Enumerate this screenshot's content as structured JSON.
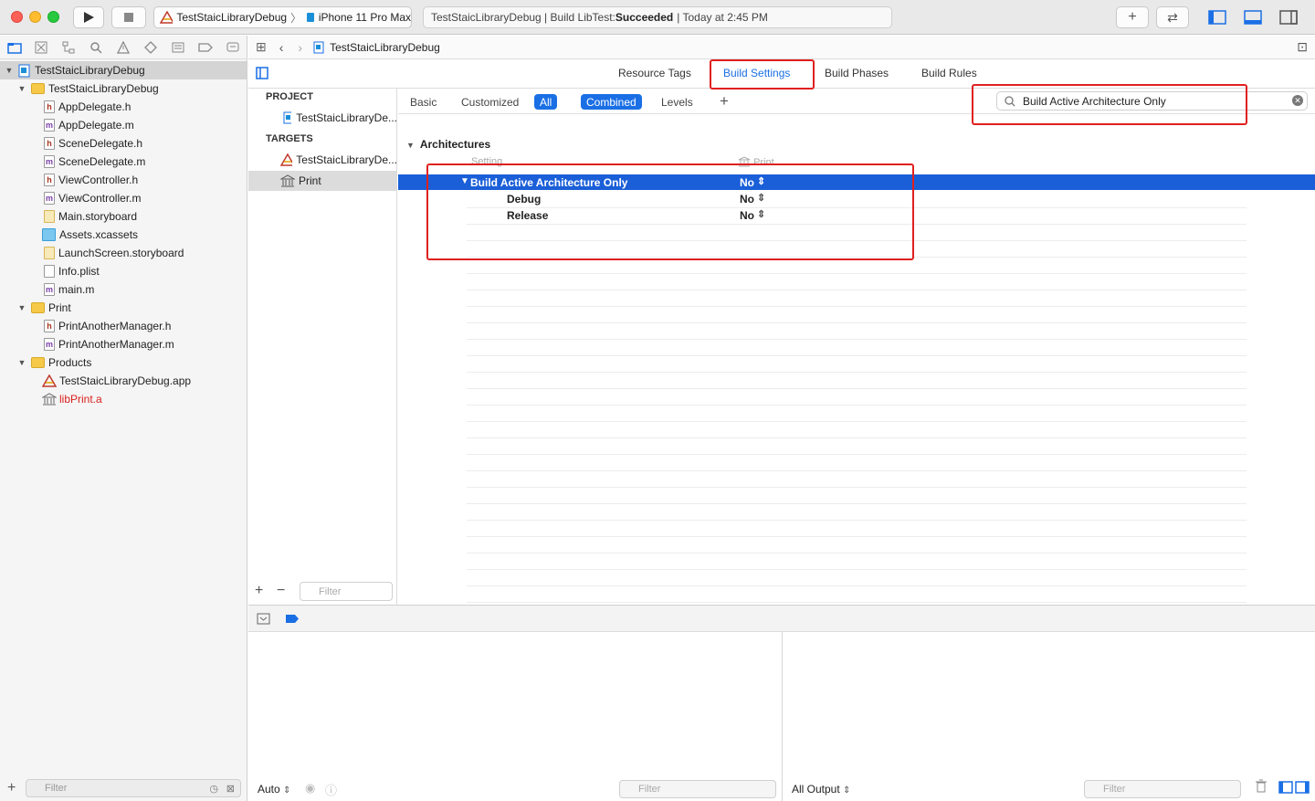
{
  "toolbar": {
    "scheme_name": "TestStaicLibraryDebug",
    "destination": "iPhone 11 Pro Max",
    "status_prefix": "TestStaicLibraryDebug | Build LibTest: ",
    "status_result": "Succeeded",
    "status_time": "| Today at 2:45 PM"
  },
  "navigator": {
    "project_name": "TestStaicLibraryDebug",
    "items": [
      {
        "label": "TestStaicLibraryDebug",
        "type": "folder"
      },
      {
        "label": "AppDelegate.h",
        "type": "h"
      },
      {
        "label": "AppDelegate.m",
        "type": "m"
      },
      {
        "label": "SceneDelegate.h",
        "type": "h"
      },
      {
        "label": "SceneDelegate.m",
        "type": "m"
      },
      {
        "label": "ViewController.h",
        "type": "h"
      },
      {
        "label": "ViewController.m",
        "type": "m"
      },
      {
        "label": "Main.storyboard",
        "type": "storyboard"
      },
      {
        "label": "Assets.xcassets",
        "type": "assets"
      },
      {
        "label": "LaunchScreen.storyboard",
        "type": "storyboard"
      },
      {
        "label": "Info.plist",
        "type": "plist"
      },
      {
        "label": "main.m",
        "type": "m"
      },
      {
        "label": "Print",
        "type": "folder"
      },
      {
        "label": "PrintAnotherManager.h",
        "type": "h"
      },
      {
        "label": "PrintAnotherManager.m",
        "type": "m"
      },
      {
        "label": "Products",
        "type": "folder"
      },
      {
        "label": "TestStaicLibraryDebug.app",
        "type": "app"
      },
      {
        "label": "libPrint.a",
        "type": "lib",
        "color": "#d9201c"
      }
    ],
    "filter_placeholder": "Filter"
  },
  "jumpbar": {
    "breadcrumb": "TestStaicLibraryDebug"
  },
  "editor_tabs": {
    "resource_tags": "Resource Tags",
    "build_settings": "Build Settings",
    "build_phases": "Build Phases",
    "build_rules": "Build Rules"
  },
  "targets_panel": {
    "project_header": "PROJECT",
    "project_item": "TestStaicLibraryDe...",
    "targets_header": "TARGETS",
    "target_app": "TestStaicLibraryDe...",
    "target_print": "Print",
    "filter_placeholder": "Filter"
  },
  "settings": {
    "filter_basic": "Basic",
    "filter_customized": "Customized",
    "filter_all": "All",
    "filter_combined": "Combined",
    "filter_levels": "Levels",
    "search_value": "Build Active Architecture Only",
    "section": "Architectures",
    "col_setting": "Setting",
    "col_target": "Print",
    "row_name": "Build Active Architecture Only",
    "row_value": "No",
    "debug_label": "Debug",
    "debug_value": "No",
    "release_label": "Release",
    "release_value": "No"
  },
  "debug_area": {
    "auto_label": "Auto",
    "filter_placeholder": "Filter",
    "output_label": "All Output",
    "filter2_placeholder": "Filter"
  },
  "colors": {
    "accent": "#1a6fe5",
    "selection": "#1a5fd8",
    "annotation": "#e0201f",
    "lib_red": "#d9201c"
  }
}
